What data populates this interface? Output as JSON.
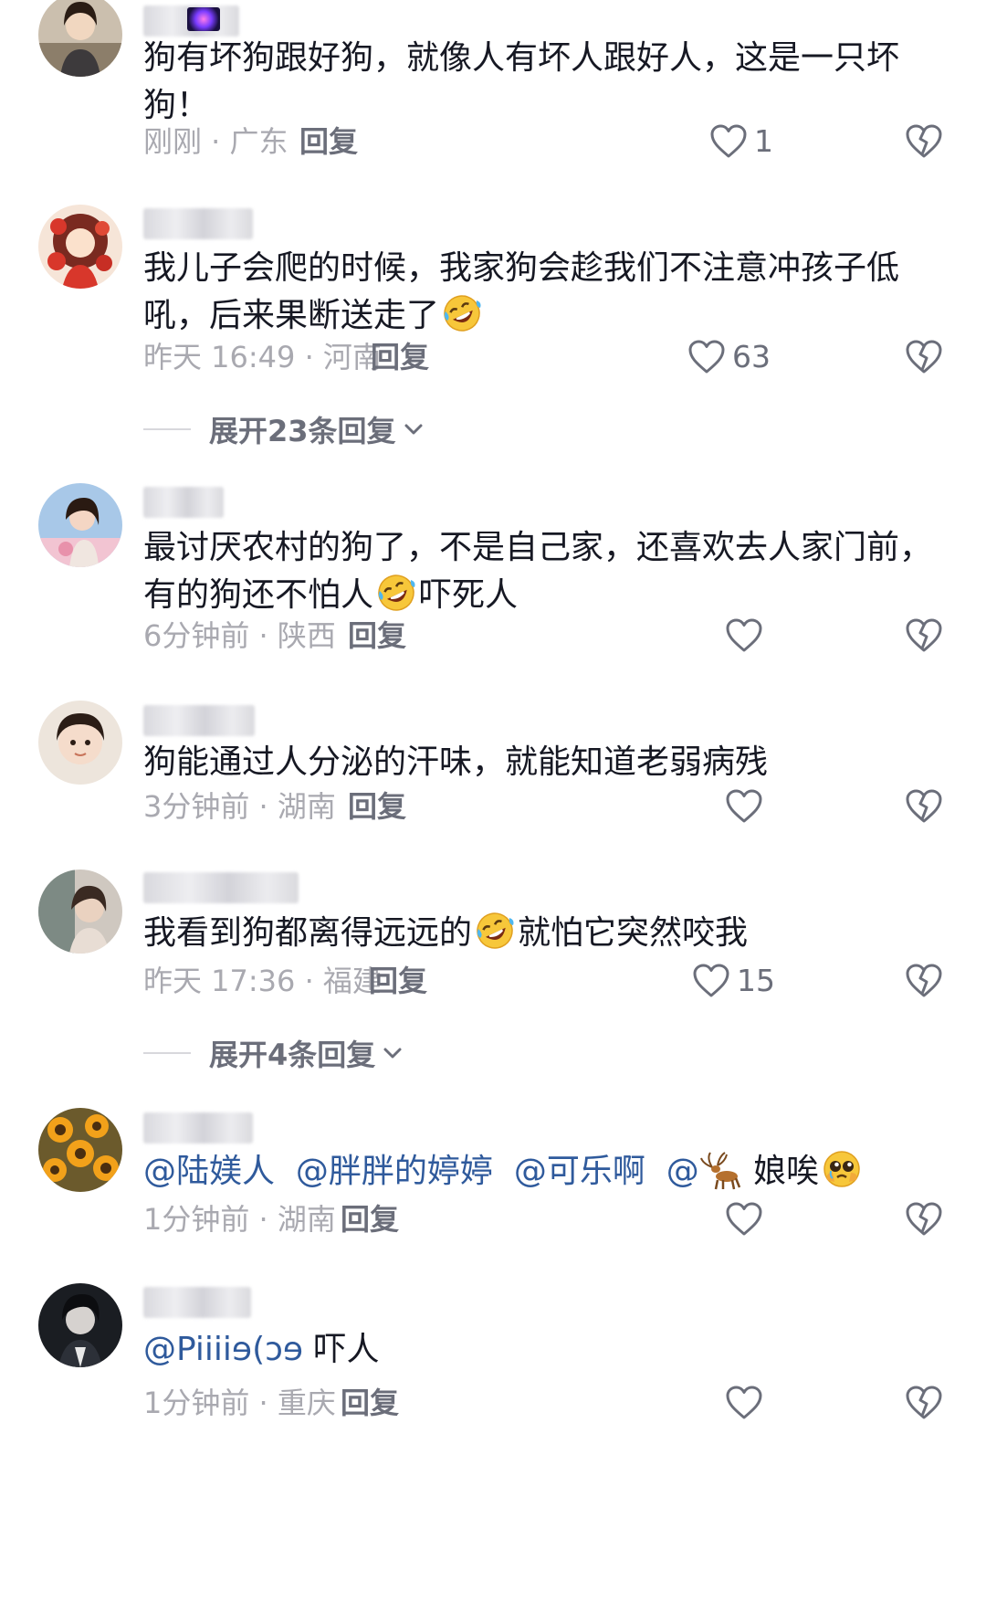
{
  "colors": {
    "text": "#161823",
    "meta": "#a9a9b0",
    "reply": "#6b6e7a",
    "mention": "#2f5a9c"
  },
  "comments": [
    {
      "content": "狗有坏狗跟好狗，就像人有坏人跟好人，这是一只坏狗！",
      "time": "刚刚 · 广东",
      "reply_label": "回复",
      "likes": "1"
    },
    {
      "content_a": "我儿子会爬的时候，我家狗会趁我们不注意冲孩子低吼，后来果断送走了",
      "emoji": "rolling-laugh-emoji",
      "time": "昨天 16:49 · 河南",
      "reply_label": "回复",
      "likes": "63",
      "expand_label": "展开23条回复"
    },
    {
      "content_a": "最讨厌农村的狗了，不是自己家，还喜欢去人家门前，有的狗还不怕人",
      "emoji": "rolling-laugh-emoji",
      "content_b": "吓死人",
      "time": "6分钟前 · 陕西",
      "reply_label": "回复",
      "likes": ""
    },
    {
      "content": "狗能通过人分泌的汗味，就能知道老弱病残",
      "time": "3分钟前 · 湖南",
      "reply_label": "回复",
      "likes": ""
    },
    {
      "content_a": "我看到狗都离得远远的",
      "emoji": "rolling-laugh-emoji",
      "content_b": "就怕它突然咬我",
      "time": "昨天 17:36 · 福建",
      "reply_label": "回复",
      "likes": "15",
      "expand_label": "展开4条回复"
    },
    {
      "mentions": [
        "@陆媄人",
        "@胖胖的婷婷",
        "@可乐啊",
        "@"
      ],
      "deer_icon": "deer-emoji",
      "content_b": "娘唉",
      "emoji": "pleading-face-emoji",
      "time": "1分钟前 · 湖南",
      "reply_label": "回复",
      "likes": ""
    },
    {
      "mention": "@Piiiiɘ(ɔɘ",
      "content_b": "吓人",
      "time": "1分钟前 · 重庆",
      "reply_label": "回复",
      "likes": ""
    }
  ]
}
